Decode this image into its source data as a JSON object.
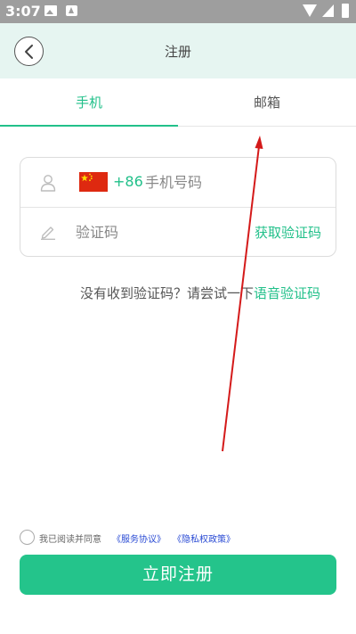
{
  "status_bar": {
    "time": "3:07"
  },
  "header": {
    "title": "注册"
  },
  "tabs": [
    {
      "label": "手机",
      "active": true
    },
    {
      "label": "邮箱",
      "active": false
    }
  ],
  "form": {
    "country_code": "+86",
    "phone_placeholder": "手机号码",
    "code_placeholder": "验证码",
    "get_code_label": "获取验证码"
  },
  "voice_hint": {
    "text": "没有收到验证码？请尝试一下",
    "link": "语音验证码"
  },
  "agreement": {
    "text": "我已阅读并同意",
    "terms_link": "《服务协议》",
    "privacy_link": "《隐私权政策》",
    "checked": false
  },
  "register_button": {
    "label": "立即注册"
  },
  "colors": {
    "accent": "#22c08a",
    "annotation": "#d41a1a",
    "link": "#2a4bd4"
  },
  "icons": {
    "user": "user-icon",
    "pen": "pen-icon",
    "flag": "china-flag-icon",
    "back": "chevron-left-icon"
  }
}
